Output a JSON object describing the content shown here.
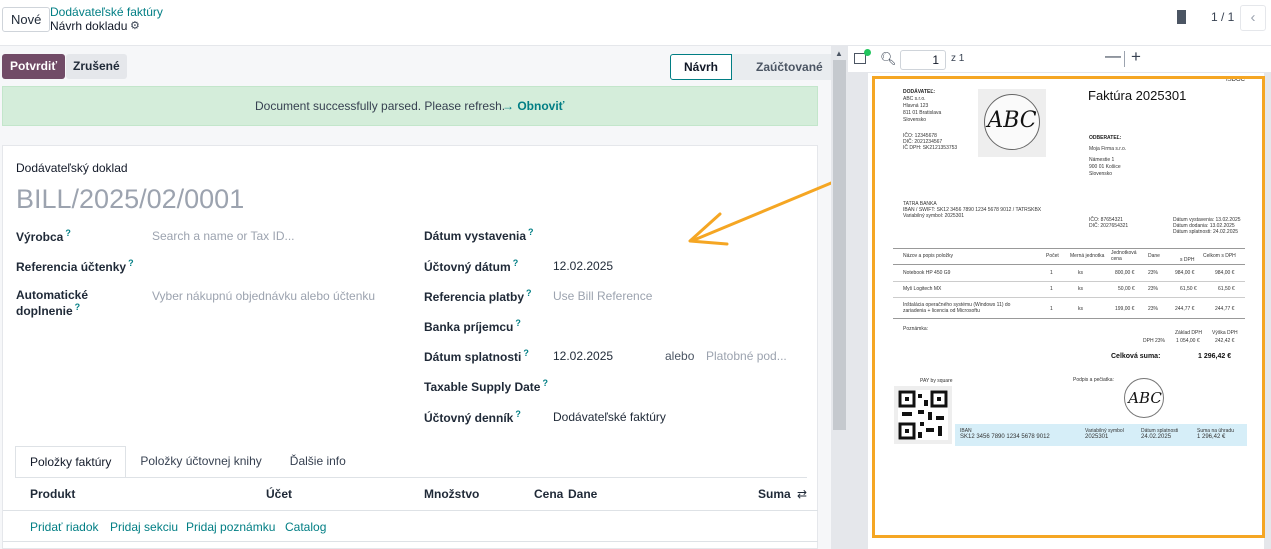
{
  "topbar": {
    "new_label": "Nové",
    "breadcrumb_parent": "Dodávateľské faktúry",
    "breadcrumb_current": "Návrh dokladu",
    "pager": "1 / 1",
    "prev_symbol": "‹"
  },
  "actions": {
    "confirm_label": "Potvrdiť",
    "cancel_label": "Zrušené"
  },
  "statusbar": {
    "steps": [
      "Návrh",
      "Zaúčtované"
    ],
    "active": "Návrh"
  },
  "alert": {
    "message": "Document successfully parsed. Please refresh.",
    "link": "→ Obnoviť",
    "color": "#d4edda"
  },
  "form": {
    "doc_type": "Dodávateľský doklad",
    "doc_number": "BILL/2025/02/0001",
    "vendor_label": "Výrobca",
    "vendor_placeholder": "Search a name or Tax ID...",
    "receipt_ref_label": "Referencia účtenky",
    "autocomplete_label_1": "Automatické",
    "autocomplete_label_2": "doplnenie",
    "autocomplete_placeholder": "Vyber nákupnú objednávku alebo účtenku",
    "invoice_date_label": "Dátum vystavenia",
    "accounting_date_label": "Účtovný dátum",
    "accounting_date_value": "12.02.2025",
    "payment_ref_label": "Referencia platby",
    "payment_ref_placeholder": "Use Bill Reference",
    "bank_label": "Banka príjemcu",
    "due_date_label": "Dátum splatnosti",
    "due_date_value": "12.02.2025",
    "or_label": "alebo",
    "payment_terms_placeholder": "Platobné pod...",
    "taxable_supply_label": "Taxable Supply Date",
    "journal_label": "Účtovný denník",
    "journal_value": "Dodávateľské faktúry",
    "help_mark": "?"
  },
  "tabs": [
    "Položky faktúry",
    "Položky účtovnej knihy",
    "Ďalšie info"
  ],
  "lines_table": {
    "headers": [
      "Produkt",
      "Účet",
      "Množstvo",
      "Cena",
      "Dane",
      "Suma"
    ],
    "add_links": [
      "Pridať riadok",
      "Pridaj sekciu",
      "Pridaj poznámku",
      "Catalog"
    ]
  },
  "pdf_viewer": {
    "page": "1",
    "of": "z 1",
    "zoom_out": "—",
    "zoom_in": "+"
  },
  "pdf": {
    "title": "Faktúra 2025301",
    "badge": "ISDOC",
    "supplier_heading": "DODÁVATEĽ:",
    "supplier_lines": [
      "ABC s.r.o.",
      "Hlavná 123",
      "811 01 Bratislava",
      "Slovensko"
    ],
    "supplier_ids": [
      "IČO: 12345678",
      "DIČ: 2021234567",
      "IČ DPH: SK2121353753"
    ],
    "stamp_text": "ABC",
    "buyer_heading": "ODBERATEĽ:",
    "buyer_lines": [
      "Moja Firma s.r.o.",
      "Námestie 1",
      "900 01 Košice",
      "Slovensko"
    ],
    "bank_lines": [
      "TATRA BANKA",
      "IBAN / SWIFT: SK12 3456 7890 1234 5678 9012 / TATRSKBX",
      "Variabilný symbol: 2025301"
    ],
    "buyer_ids": [
      "IČO: 87654321",
      "DIČ: 2027654321"
    ],
    "dates": [
      "Dátum vystavenia: 13.02.2025",
      "Dátum dodania: 13.02.2025",
      "Dátum splatnosti: 24.02.2025"
    ],
    "item_headers": [
      "Názov a popis položky",
      "Počet",
      "Merná jednotka",
      "Jednotková cena",
      "Dane",
      "s DPH",
      "Celkom s DPH"
    ],
    "items": [
      [
        "Notebook HP 450 G9",
        "1",
        "ks",
        "800,00 €",
        "23%",
        "984,00 €",
        "984,00 €"
      ],
      [
        "Myš Logitech MX",
        "1",
        "ks",
        "50,00 €",
        "23%",
        "61,50 €",
        "61,50 €"
      ],
      [
        "Inštalácia operačného systému (Windows 11) do zariadenia + licencia od Microsoftu",
        "1",
        "ks",
        "199,00 €",
        "23%",
        "244,77 €",
        "244,77 €"
      ]
    ],
    "note_label": "Poznámka:",
    "summary_headers": [
      "Základ DPH",
      "Výška DPH"
    ],
    "summary_row": [
      "DPH 23%",
      "1 054,00 €",
      "242,42 €"
    ],
    "total_label": "Celková suma:",
    "total_value": "1 296,42 €",
    "pay_by_square": "PAY by square",
    "signature_label": "Podpis a pečiatka:",
    "pay_labels": [
      "IBAN",
      "Variabilný symbol",
      "Dátum splatnosti",
      "Suma na úhradu"
    ],
    "pay_values": [
      "SK12 3456 7890 1234 5678 9012",
      "2025301",
      "24.02.2025",
      "1 296,42 €"
    ]
  },
  "colors": {
    "primary": "#714b67",
    "accent": "#017e84",
    "highlight": "#f5a623"
  }
}
